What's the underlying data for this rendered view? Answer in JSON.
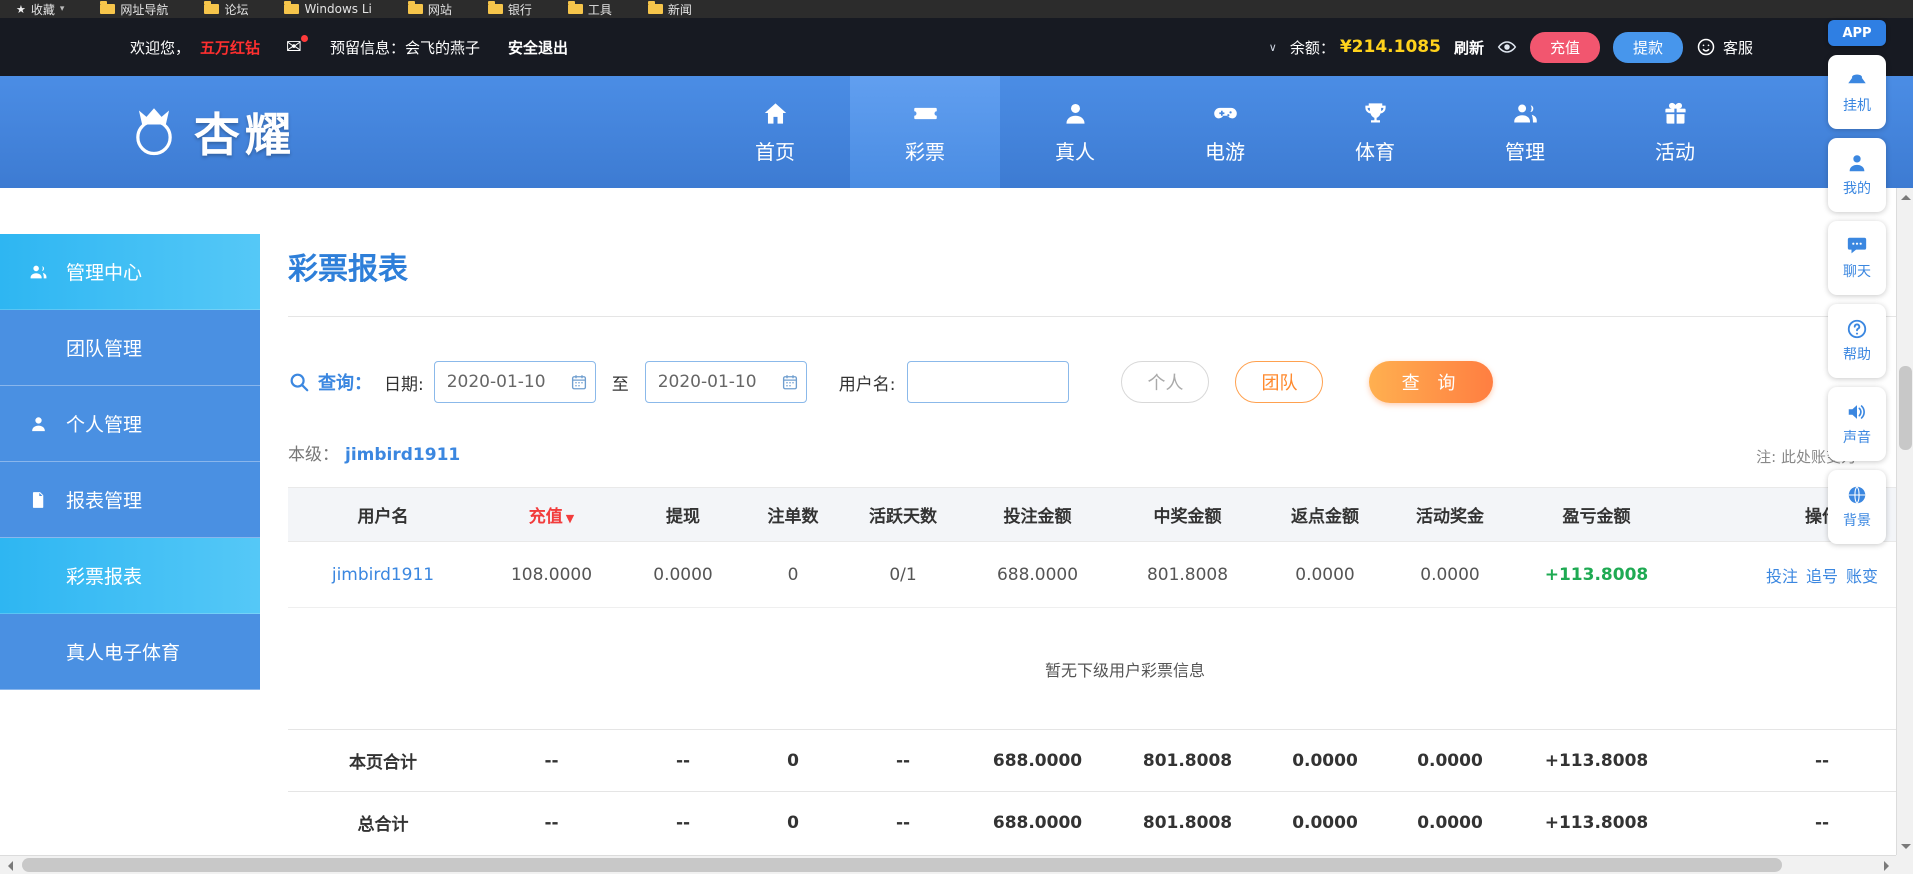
{
  "bookmarks": {
    "star": "收藏",
    "items": [
      "网址导航",
      "论坛",
      "Windows Li",
      "网站",
      "银行",
      "工具",
      "新闻"
    ]
  },
  "topbar": {
    "welcome": "欢迎您，",
    "username": "五万红钻",
    "reserved": "预留信息：会飞的燕子",
    "logout": "安全退出",
    "balance_label": "余额：",
    "balance": "¥214.1085",
    "refresh": "刷新",
    "recharge": "充值",
    "withdraw": "提款",
    "service": "客服"
  },
  "nav": {
    "brand": "杏耀",
    "items": [
      {
        "label": "首页"
      },
      {
        "label": "彩票"
      },
      {
        "label": "真人"
      },
      {
        "label": "电游"
      },
      {
        "label": "体育"
      },
      {
        "label": "管理"
      },
      {
        "label": "活动"
      }
    ]
  },
  "panel": {
    "app": "APP",
    "items": [
      {
        "label": "挂机"
      },
      {
        "label": "我的"
      },
      {
        "label": "聊天"
      },
      {
        "label": "帮助"
      },
      {
        "label": "声音"
      },
      {
        "label": "背景"
      }
    ]
  },
  "sidebar": {
    "items": [
      {
        "label": "管理中心"
      },
      {
        "label": "团队管理"
      },
      {
        "label": "个人管理"
      },
      {
        "label": "报表管理"
      },
      {
        "label": "彩票报表"
      },
      {
        "label": "真人电子体育"
      }
    ]
  },
  "main": {
    "title": "彩票报表",
    "search": {
      "query_label": "查询：",
      "date_label": "日期:",
      "date_from": "2020-01-10",
      "to": "至",
      "date_to": "2020-01-10",
      "username_label": "用户名:",
      "username_value": "",
      "personal": "个人",
      "team": "团队",
      "submit": "查 询"
    },
    "level_label": "本级：",
    "level_user": "jimbird1911",
    "note": "注: 此处账变为",
    "table": {
      "headers": [
        "用户名",
        "充值",
        "提现",
        "注单数",
        "活跃天数",
        "投注金额",
        "中奖金额",
        "返点金额",
        "活动奖金",
        "盈亏金额",
        "操作"
      ],
      "sort_icon": "▼",
      "row": {
        "username": "jimbird1911",
        "recharge": "108.0000",
        "withdraw": "0.0000",
        "orders": "0",
        "active_days": "0/1",
        "bet": "688.0000",
        "win": "801.8008",
        "rebate": "0.0000",
        "bonus": "0.0000",
        "profit": "+113.8008",
        "actions": [
          "投注",
          "追号",
          "账变"
        ]
      },
      "empty": "暂无下级用户彩票信息",
      "page_total_label": "本页合计",
      "page_total": [
        "--",
        "--",
        "0",
        "--",
        "688.0000",
        "801.8008",
        "0.0000",
        "0.0000",
        "+113.8008",
        "--"
      ],
      "grand_total_label": "总合计",
      "grand_total": [
        "--",
        "--",
        "0",
        "--",
        "688.0000",
        "801.8008",
        "0.0000",
        "0.0000",
        "+113.8008",
        "--"
      ]
    }
  },
  "colors": {
    "accent_blue": "#3b87e0",
    "nav_blue": "#4181d8",
    "active_cyan": "#38b6f3",
    "orange": "#ff7e41",
    "green": "#1faa53",
    "red": "#f23c3c",
    "yellow": "#ffd21c"
  }
}
